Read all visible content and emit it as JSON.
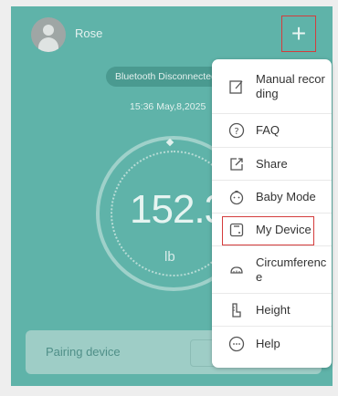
{
  "user": {
    "name": "Rose"
  },
  "status": {
    "bluetooth": "Bluetooth Disconnected",
    "datetime": "15:36 May,8,2025"
  },
  "measurement": {
    "weight": "152.3",
    "unit": "lb"
  },
  "pairing": {
    "label": "Pairing device"
  },
  "menu": {
    "items": [
      {
        "label": "Manual recording",
        "icon": "edit-icon"
      },
      {
        "label": "FAQ",
        "icon": "question-circle-icon"
      },
      {
        "label": "Share",
        "icon": "share-icon"
      },
      {
        "label": "Baby Mode",
        "icon": "baby-face-icon"
      },
      {
        "label": "My Device",
        "icon": "scale-device-icon"
      },
      {
        "label": "Circumference",
        "icon": "tape-measure-icon"
      },
      {
        "label": "Height",
        "icon": "height-icon"
      },
      {
        "label": "Help",
        "icon": "chat-bubble-icon"
      }
    ]
  },
  "colors": {
    "background": "#5fb3a9",
    "highlight": "#d43c3c",
    "menu_background": "#ffffff"
  }
}
